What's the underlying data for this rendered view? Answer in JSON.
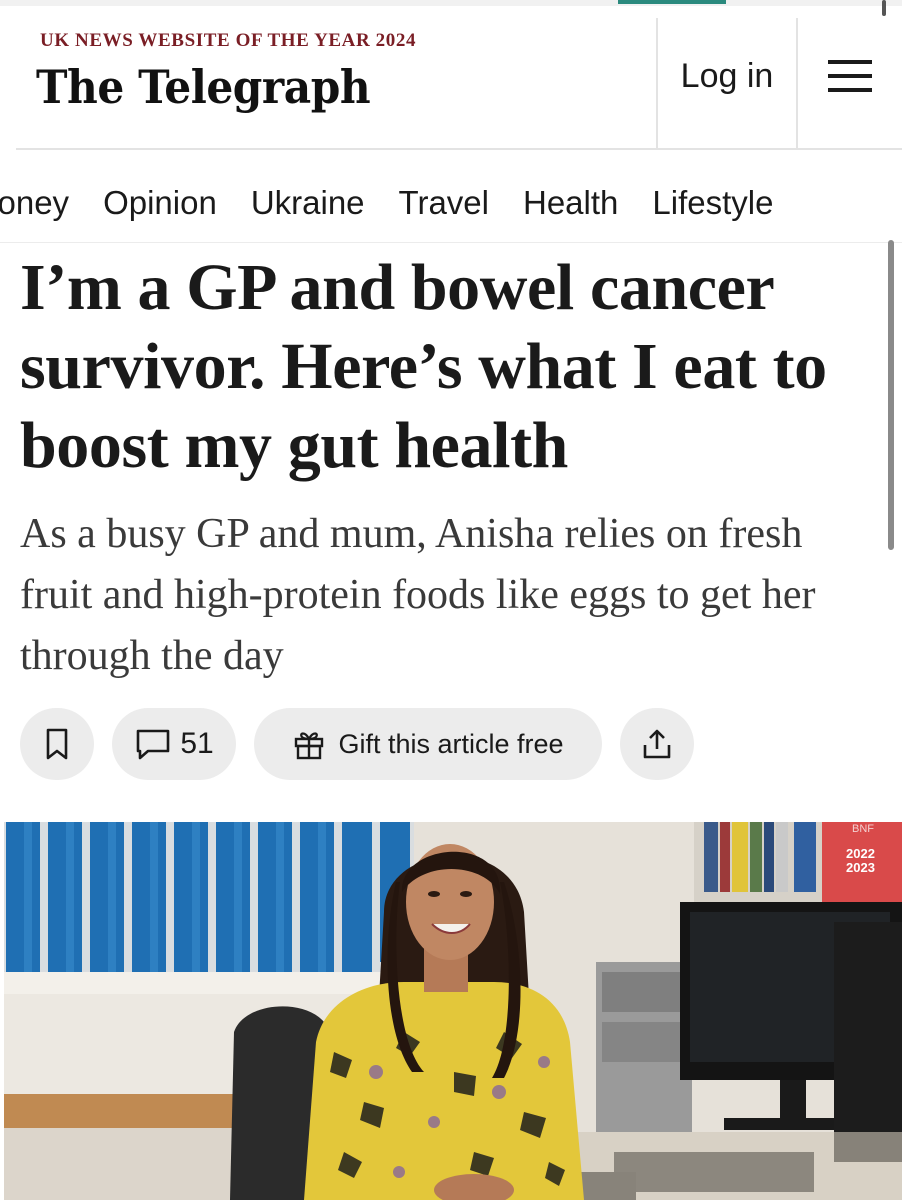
{
  "header": {
    "tagline": "UK NEWS WEBSITE OF THE YEAR 2024",
    "logo": "The Telegraph",
    "login_label": "Log in",
    "menu_icon": "hamburger-menu-icon"
  },
  "nav": {
    "items": [
      "Money",
      "Opinion",
      "Ukraine",
      "Travel",
      "Health",
      "Lifestyle"
    ]
  },
  "article": {
    "headline": "I’m a GP and bowel cancer survivor. Here’s what I eat to boost my gut health",
    "standfirst": "As a busy GP and mum, Anisha relies on fresh fruit and high-protein foods like eggs to get her through the day"
  },
  "actions": {
    "bookmark_icon": "bookmark-icon",
    "comments_icon": "comment-bubble-icon",
    "comment_count": "51",
    "gift_icon": "gift-icon",
    "gift_label": "Gift this article free",
    "share_icon": "share-icon"
  },
  "photo": {
    "book_label_top": "BNF",
    "book_label_years": "2022\n2023"
  },
  "colors": {
    "tagline": "#7a1e25",
    "accent": "#2b8a7e",
    "pill_bg": "#ececec"
  }
}
